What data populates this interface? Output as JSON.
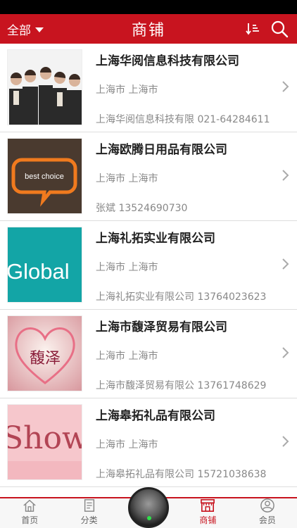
{
  "header": {
    "filter_label": "全部",
    "title": "商铺"
  },
  "colors": {
    "brand": "#c8141f",
    "tab_active": "#c8141f"
  },
  "icons": {
    "sort": "sort-icon",
    "search": "search-icon"
  },
  "shops": [
    {
      "name": "上海华阅信息科技有限公司",
      "city": "上海市 上海市",
      "contact": "上海华阅信息科技有限 021-64284611",
      "thumb": "team-photo"
    },
    {
      "name": "上海欧腾日用品有限公司",
      "city": "上海市 上海市",
      "contact": "张斌 13524690730",
      "thumb_text": "best choice"
    },
    {
      "name": "上海礼拓实业有限公司",
      "city": "上海市 上海市",
      "contact": "上海礼拓实业有限公司 13764023623",
      "thumb_text": "Global"
    },
    {
      "name": "上海市馥泽贸易有限公司",
      "city": "上海市 上海市",
      "contact": "上海市馥泽贸易有限公 13761748629",
      "thumb_text": "馥泽"
    },
    {
      "name": "上海皋拓礼品有限公司",
      "city": "上海市 上海市",
      "contact": "上海皋拓礼品有限公司 15721038638",
      "thumb_text": "Show"
    }
  ],
  "tabs": [
    {
      "label": "首页",
      "icon": "home-icon"
    },
    {
      "label": "分类",
      "icon": "category-icon"
    },
    {
      "label": "商铺",
      "icon": "shop-icon",
      "active": true
    },
    {
      "label": "会员",
      "icon": "member-icon"
    }
  ]
}
